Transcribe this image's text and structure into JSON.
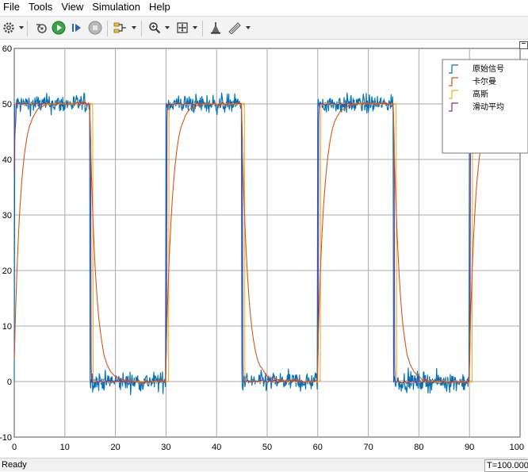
{
  "menu": {
    "items": [
      {
        "name": "menu-file",
        "label": "File"
      },
      {
        "name": "menu-tools",
        "label": "Tools"
      },
      {
        "name": "menu-view",
        "label": "View"
      },
      {
        "name": "menu-simulation",
        "label": "Simulation"
      },
      {
        "name": "menu-help",
        "label": "Help"
      }
    ]
  },
  "toolbar": {
    "icons": [
      "settings-icon",
      "restore-icon",
      "run-icon",
      "step-forward-icon",
      "stop-icon",
      "signal-selector-icon",
      "zoom-icon",
      "fit-to-view-icon",
      "highlight-icon",
      "style-icon"
    ]
  },
  "status": {
    "text": "Ready",
    "time": "T=100.000"
  },
  "colors": {
    "raw": "#0072BD",
    "kalman": "#D95319",
    "gauss": "#EDB120",
    "moving_avg": "#7E2F8E",
    "grid": "#a9a9a9",
    "background": "#ffffff"
  },
  "chart_data": {
    "type": "line",
    "xlim": [
      0,
      100
    ],
    "ylim": [
      -10,
      60
    ],
    "x_ticks": [
      0,
      10,
      20,
      30,
      40,
      50,
      60,
      70,
      80,
      90,
      100
    ],
    "y_ticks": [
      -10,
      0,
      10,
      20,
      30,
      40,
      50,
      60
    ],
    "grid": true,
    "legend_position": "top-right",
    "high_level": 50,
    "low_level": 0,
    "transitions": [
      {
        "t": 0,
        "to": 50
      },
      {
        "t": 15,
        "to": 0
      },
      {
        "t": 30,
        "to": 50
      },
      {
        "t": 45,
        "to": 0
      },
      {
        "t": 60,
        "to": 50
      },
      {
        "t": 75,
        "to": 0
      },
      {
        "t": 90,
        "to": 50
      }
    ],
    "series": [
      {
        "name": "原始信号",
        "color": "#0072BD",
        "noise_amplitude": 1.2
      },
      {
        "name": "卡尔曼",
        "color": "#D95319",
        "time_constant": 1.3
      },
      {
        "name": "高斯",
        "color": "#EDB120",
        "delay": 0.6
      },
      {
        "name": "滑动平均",
        "color": "#7E2F8E",
        "delay": 0.2
      }
    ]
  }
}
